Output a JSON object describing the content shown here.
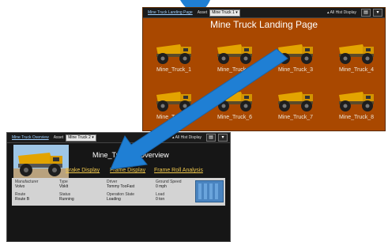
{
  "colors": {
    "landing_bg": "#a94800",
    "arrow": "#1f7fd4",
    "link": "#f2c94c",
    "toolbar": "#1b1b1b",
    "panel": "#d3d3d3"
  },
  "landing": {
    "toolbar": {
      "crumb": "Mine Truck Landing Page",
      "asset_label": "Asset",
      "asset_value": "Mine Truck 1",
      "hist_label": "All Hist Display"
    },
    "title": "Mine Truck Landing Page",
    "trucks": [
      {
        "label": "Mine_Truck_1"
      },
      {
        "label": "Mine_Truck_2"
      },
      {
        "label": "Mine_Truck_3"
      },
      {
        "label": "Mine_Truck_4"
      },
      {
        "label": "Mine_Truck_5"
      },
      {
        "label": "Mine_Truck_6"
      },
      {
        "label": "Mine_Truck_7"
      },
      {
        "label": "Mine_Truck_8"
      }
    ]
  },
  "overview": {
    "toolbar": {
      "crumb": "Mine Truck Overview",
      "asset_label": "Asset",
      "asset_value": "Mine Truck 2",
      "hist_label": "All Hist Display"
    },
    "title": "Mine_Truck_2 Overview",
    "links": [
      "Brake Display",
      "Frame Display",
      "Frame Roll Analysis"
    ],
    "fields": [
      {
        "k": "Manufacturer",
        "v": "Volvo"
      },
      {
        "k": "Type",
        "v": "Vbklt"
      },
      {
        "k": "Driver",
        "v": "Tommy TooFast"
      },
      {
        "k": "Ground Speed",
        "v": "0 mph"
      },
      {
        "k": "Route",
        "v": "Route B"
      },
      {
        "k": "Status",
        "v": "Running"
      },
      {
        "k": "Operation State",
        "v": "Loading"
      },
      {
        "k": "Load",
        "v": "0 ton"
      }
    ]
  }
}
